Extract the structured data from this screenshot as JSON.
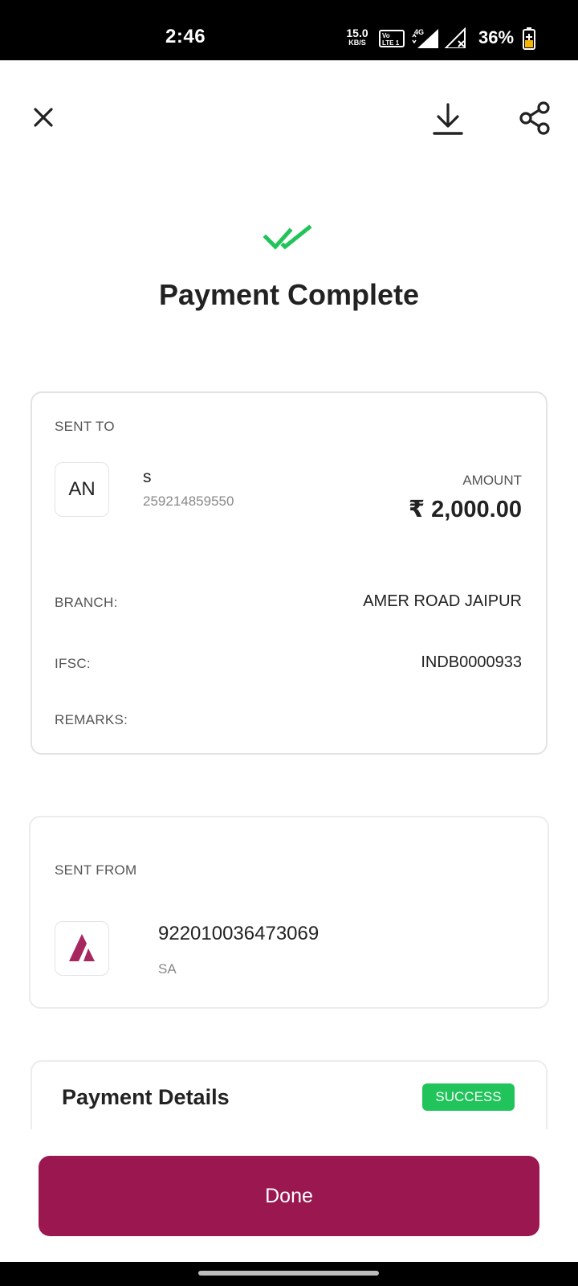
{
  "status_bar": {
    "time": "2:46",
    "net_speed_value": "15.0",
    "net_speed_unit": "KB/S",
    "volte_line1": "Vo",
    "volte_line2": "LTE 1",
    "network_type": "4G",
    "battery_percent": "36%"
  },
  "toolbar": {
    "close_icon": "close-icon",
    "download_icon": "download-icon",
    "share_icon": "share-icon"
  },
  "header": {
    "title": "Payment Complete",
    "status_icon": "double-check-icon",
    "accent_color": "#20c45a"
  },
  "sent_to": {
    "label": "SENT TO",
    "initials": "AN",
    "name": "s",
    "account_number": "259214859550",
    "amount_label": "AMOUNT",
    "amount": "₹ 2,000.00",
    "branch_label": "BRANCH:",
    "branch_value": "AMER ROAD JAIPUR",
    "ifsc_label": "IFSC:",
    "ifsc_value": "INDB0000933",
    "remarks_label": "REMARKS:"
  },
  "sent_from": {
    "label": "SENT FROM",
    "bank_logo": "axis-bank-logo",
    "account_number": "922010036473069",
    "account_type": "SA"
  },
  "payment_details": {
    "title": "Payment Details",
    "status": "SUCCESS",
    "status_color": "#20c45a"
  },
  "footer": {
    "done_label": "Done",
    "button_color": "#9a1750"
  }
}
